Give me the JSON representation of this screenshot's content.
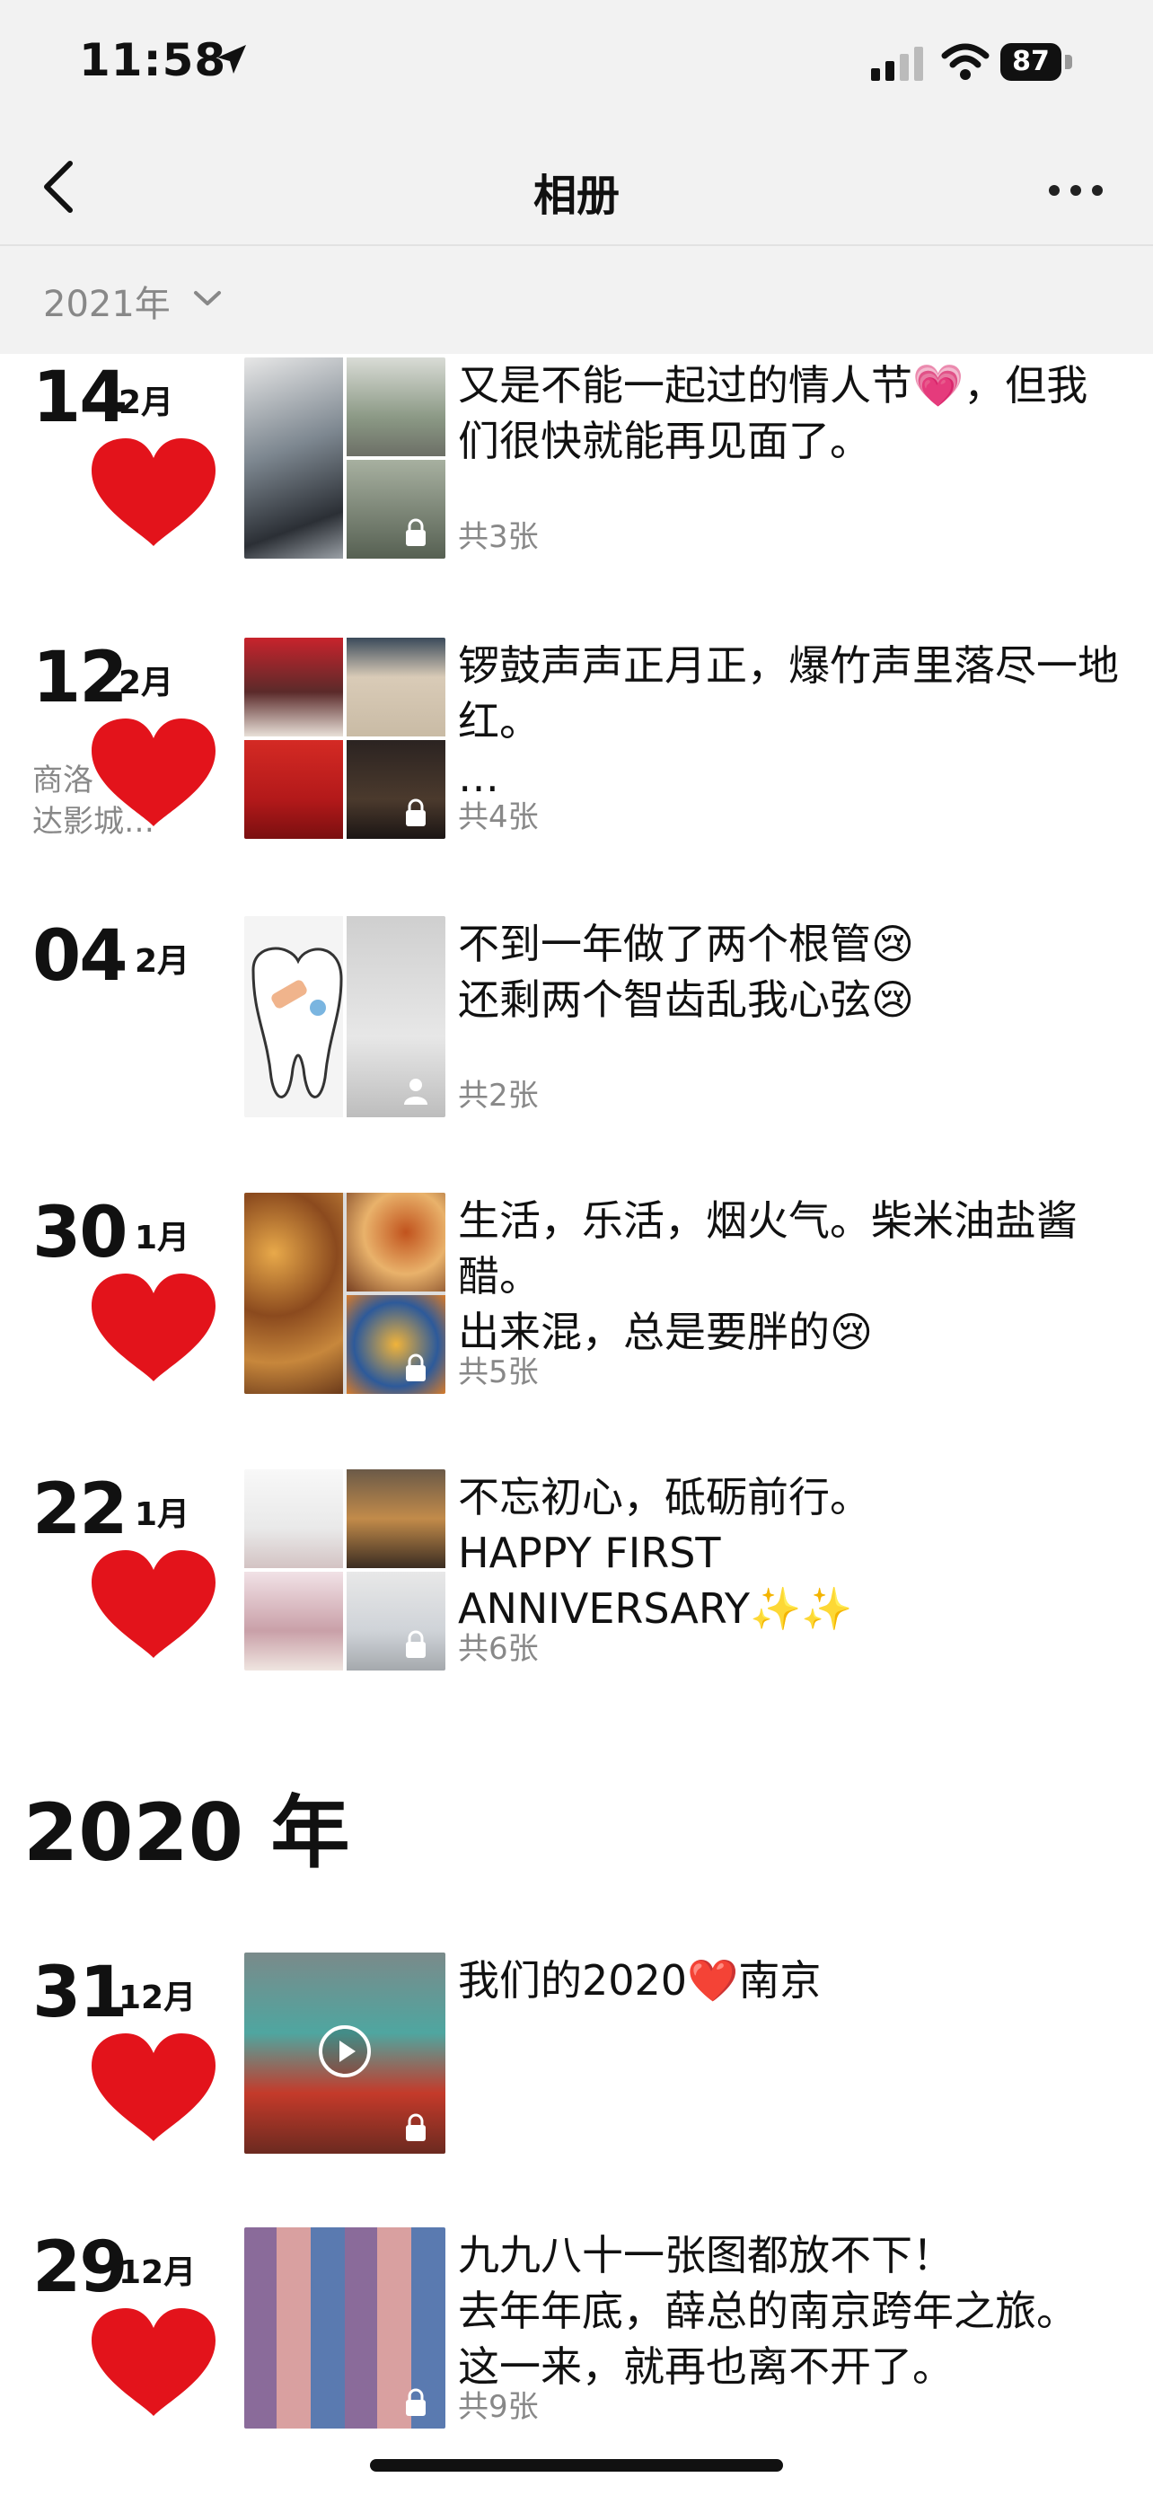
{
  "status_bar": {
    "time": "11:58",
    "battery": "87"
  },
  "nav": {
    "title": "相册"
  },
  "filter": {
    "year_label": "2021年"
  },
  "entries_2021": [
    {
      "day": "14",
      "month": "2月",
      "caption": "又是不能一起过的情人节💗，但我们很快就能再见面了。",
      "count": "共3张",
      "location": ""
    },
    {
      "day": "12",
      "month": "2月",
      "caption": "锣鼓声声正月正，爆竹声里落尽一地红。\n…",
      "count": "共4张",
      "location": "商洛\n达影城…"
    },
    {
      "day": "04",
      "month": "2月",
      "caption": "不到一年做了两个根管😢\n还剩两个智齿乱我心弦😢",
      "count": "共2张",
      "location": ""
    },
    {
      "day": "30",
      "month": "1月",
      "caption": "生活，乐活，烟火气。柴米油盐酱醋。\n出来混，总是要胖的😢",
      "count": "共5张",
      "location": ""
    },
    {
      "day": "22",
      "month": "1月",
      "caption": "不忘初心，砥砺前行。\nHAPPY FIRST ANNIVERSARY✨✨",
      "count": "共6张",
      "location": ""
    }
  ],
  "year_heading": "2020 年",
  "entries_2020": [
    {
      "day": "31",
      "month": "12月",
      "caption": "我们的2020❤️南京",
      "count": "",
      "location": ""
    },
    {
      "day": "29",
      "month": "12月",
      "caption": "九九八十一张图都放不下！\n去年年底，薛总的南京跨年之旅。\n这一来，就再也离不开了。",
      "count": "共9张",
      "location": ""
    }
  ],
  "colors": {
    "heart": "#e3131b",
    "bar_bg": "#f2f2f2",
    "secondary_text": "#888888"
  },
  "icons": [
    "location-arrow-icon",
    "signal-icon",
    "wifi-icon",
    "back-chevron-icon",
    "more-icon",
    "chevron-down-icon",
    "heart-icon",
    "lock-icon",
    "play-icon",
    "person-icon"
  ]
}
